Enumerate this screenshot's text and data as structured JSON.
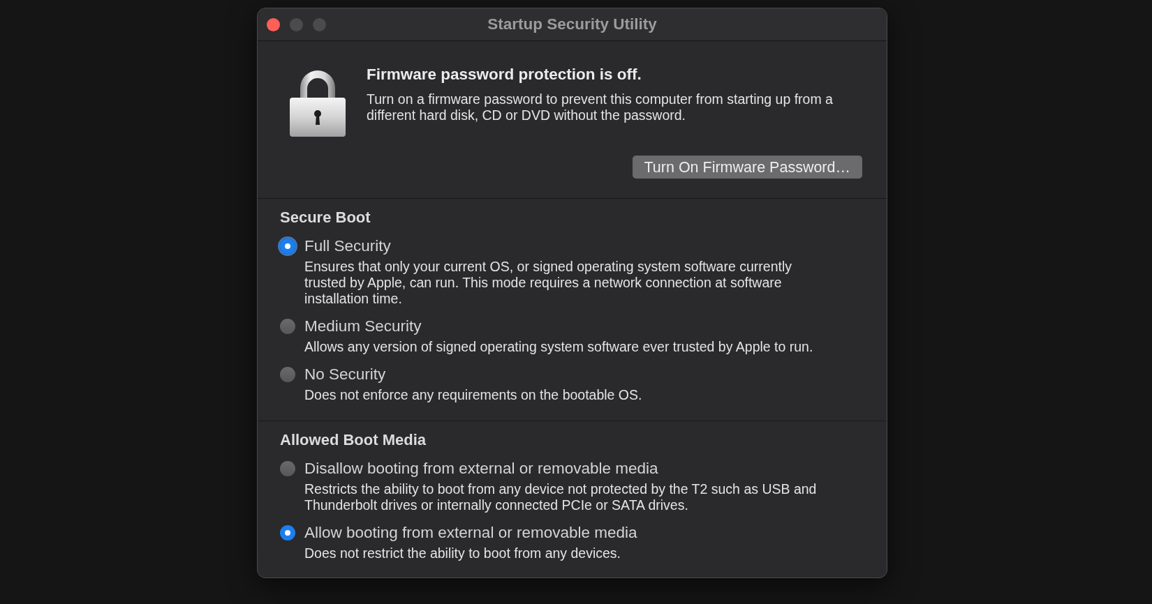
{
  "window": {
    "title": "Startup Security Utility",
    "controls": [
      {
        "kind": "close",
        "disabled": false
      },
      {
        "kind": "minimize",
        "disabled": true
      },
      {
        "kind": "zoom",
        "disabled": true
      }
    ]
  },
  "firmware": {
    "heading": "Firmware password protection is off.",
    "description": "Turn on a firmware password to prevent this computer from starting up from a different hard disk, CD or DVD without the password.",
    "button": "Turn On Firmware Password…"
  },
  "sections": [
    {
      "title": "Secure Boot",
      "options": [
        {
          "label": "Full Security",
          "description": "Ensures that only your current OS, or signed operating system software currently trusted by Apple, can run. This mode requires a network connection at software installation time.",
          "selected": true,
          "focused": true
        },
        {
          "label": "Medium Security",
          "description": "Allows any version of signed operating system software ever trusted by Apple to run.",
          "selected": false,
          "focused": false
        },
        {
          "label": "No Security",
          "description": "Does not enforce any requirements on the bootable OS.",
          "selected": false,
          "focused": false
        }
      ]
    },
    {
      "title": "Allowed Boot Media",
      "options": [
        {
          "label": "Disallow booting from external or removable media",
          "description": "Restricts the ability to boot from any device not protected by the T2 such as USB and Thunderbolt drives or internally connected PCIe or SATA drives.",
          "selected": false,
          "focused": false
        },
        {
          "label": "Allow booting from external or removable media",
          "description": "Does not restrict the ability to boot from any devices.",
          "selected": true,
          "focused": false
        }
      ]
    }
  ]
}
